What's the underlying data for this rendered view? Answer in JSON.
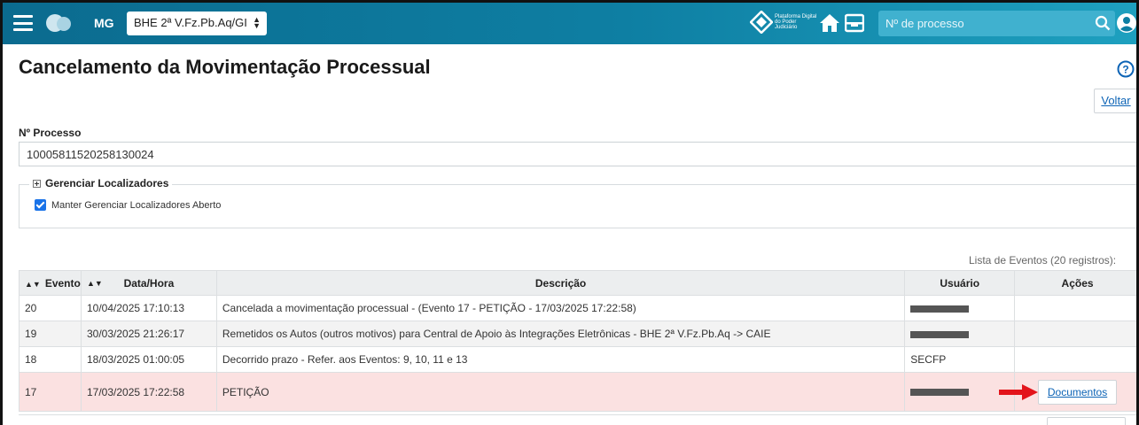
{
  "topbar": {
    "uf": "MG",
    "unit_select": "BHE 2ª V.Fz.Pb.Aq/GI",
    "logo_text": "Plataforma Digital do Poder Judiciário",
    "search_placeholder": "Nº de processo",
    "colors": {
      "bar_start": "#0b6b8f",
      "bar_end": "#1ea0bf",
      "search_bg": "#40b1cf"
    }
  },
  "page": {
    "title": "Cancelamento da Movimentação Processual",
    "back_button": "Voltar"
  },
  "process": {
    "label": "Nº Processo",
    "number": "10005811520258130024"
  },
  "locators": {
    "legend": "Gerenciar Localizadores",
    "keep_open_label": "Manter Gerenciar Localizadores Aberto",
    "keep_open_checked": true
  },
  "events": {
    "caption": "Lista de Eventos (20 registros):",
    "columns": [
      "Evento",
      "Data/Hora",
      "Descrição",
      "Usuário",
      "Ações"
    ],
    "rows": [
      {
        "evento": "20",
        "data": "10/04/2025 17:10:13",
        "descricao": "Cancelada a movimentação processual - (Evento 17 - PETIÇÃO - 17/03/2025 17:22:58)",
        "usuario": "",
        "acao": ""
      },
      {
        "evento": "19",
        "data": "30/03/2025 21:26:17",
        "descricao": "Remetidos os Autos (outros motivos) para Central de Apoio às Integrações Eletrônicas - BHE 2ª V.Fz.Pb.Aq -> CAIE",
        "usuario": "",
        "acao": ""
      },
      {
        "evento": "18",
        "data": "18/03/2025 01:00:05",
        "descricao": "Decorrido prazo - Refer. aos Eventos: 9, 10, 11 e 13",
        "usuario": "SECFP",
        "acao": ""
      },
      {
        "evento": "17",
        "data": "17/03/2025 17:22:58",
        "descricao": "PETIÇÃO",
        "usuario": "",
        "acao": "Documentos"
      }
    ],
    "highlight_color": "#fbe1e1",
    "next_action": "Documentos"
  }
}
